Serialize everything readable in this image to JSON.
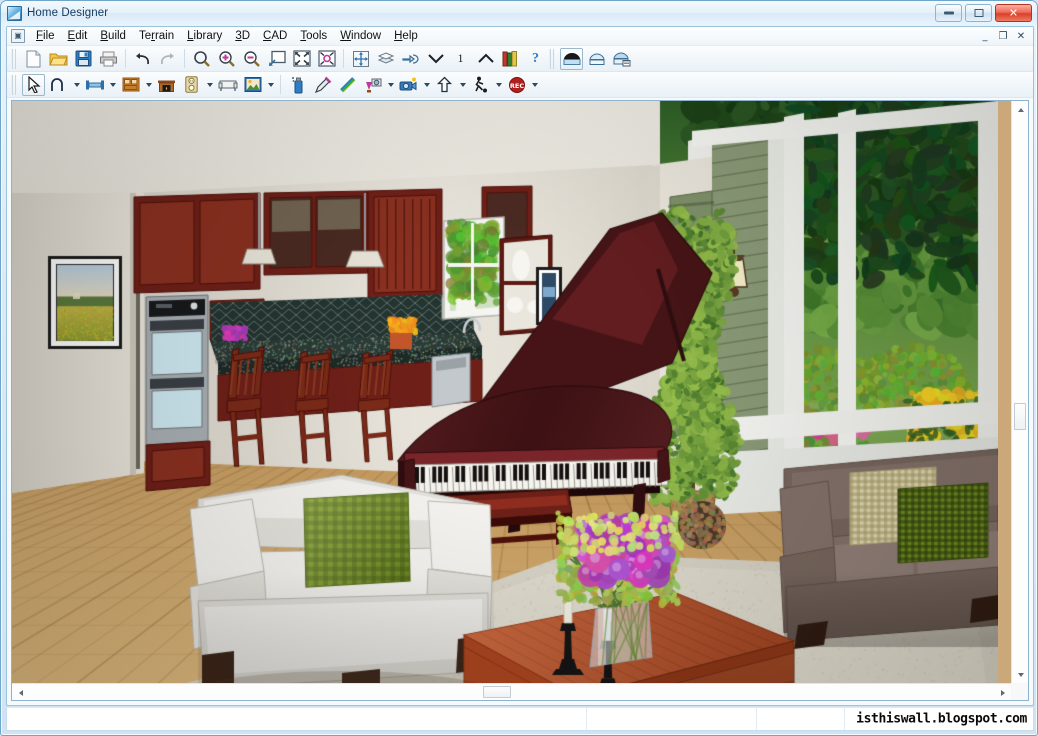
{
  "window": {
    "title": "Home Designer",
    "app_icon": "home-designer-logo-icon",
    "controls": {
      "minimize_label": "–",
      "maximize_label": "□",
      "close_label": "✕"
    }
  },
  "mdi": {
    "system_icon": "document-system-icon",
    "restore_label": "–",
    "maximize_label": "❐",
    "close_label": "✕"
  },
  "menubar": {
    "items": [
      {
        "label": "File",
        "accel": "F"
      },
      {
        "label": "Edit",
        "accel": "E"
      },
      {
        "label": "Build",
        "accel": "B"
      },
      {
        "label": "Terrain",
        "accel": "r"
      },
      {
        "label": "Library",
        "accel": "L"
      },
      {
        "label": "3D",
        "accel": "3"
      },
      {
        "label": "CAD",
        "accel": "C"
      },
      {
        "label": "Tools",
        "accel": "T"
      },
      {
        "label": "Window",
        "accel": "W"
      },
      {
        "label": "Help",
        "accel": "H"
      }
    ]
  },
  "toolbar_standard": {
    "buttons": [
      {
        "icon": "new-document-icon",
        "tooltip": "New Plan"
      },
      {
        "icon": "open-folder-icon",
        "tooltip": "Open Plan"
      },
      {
        "icon": "save-disk-icon",
        "tooltip": "Save Plan"
      },
      {
        "icon": "printer-icon",
        "tooltip": "Print"
      },
      {
        "icon": "undo-arrow-icon",
        "tooltip": "Undo"
      },
      {
        "icon": "redo-arrow-icon",
        "tooltip": "Redo",
        "disabled": true
      },
      {
        "icon": "zoom-magnifier-icon",
        "tooltip": "Zoom"
      },
      {
        "icon": "zoom-in-icon",
        "tooltip": "Zoom In"
      },
      {
        "icon": "zoom-out-icon",
        "tooltip": "Zoom Out"
      },
      {
        "icon": "fill-window-icon",
        "tooltip": "Fill Window"
      },
      {
        "icon": "fit-all-icon",
        "tooltip": "Fill Window Building Only"
      },
      {
        "icon": "center-target-icon",
        "tooltip": "Center View"
      },
      {
        "icon": "pan-move-icon",
        "tooltip": "Pan Window"
      },
      {
        "icon": "floor-up-down-icon",
        "tooltip": "Reference Display"
      },
      {
        "icon": "hand-point-icon",
        "tooltip": "Select Floor"
      },
      {
        "icon": "down-chevron-icon",
        "tooltip": "Down One Floor"
      },
      {
        "icon": "floor-number-icon",
        "tooltip": "Floor 1"
      },
      {
        "icon": "up-chevron-icon",
        "tooltip": "Up One Floor"
      },
      {
        "icon": "library-books-icon",
        "tooltip": "Library Browser"
      },
      {
        "icon": "help-question-icon",
        "tooltip": "Help"
      },
      {
        "icon": "camera-full-view-icon",
        "tooltip": "Full Camera"
      },
      {
        "icon": "house-overview-icon",
        "tooltip": "Overview"
      },
      {
        "icon": "house-doll-icon",
        "tooltip": "Doll House View"
      }
    ]
  },
  "toolbar_tools": {
    "buttons": [
      {
        "icon": "select-arrow-icon",
        "tooltip": "Select Objects",
        "active": true
      },
      {
        "icon": "curve-line-icon",
        "tooltip": "CAD Tools",
        "has_dropdown": true
      },
      {
        "icon": "wall-tool-icon",
        "tooltip": "Walls",
        "has_dropdown": true
      },
      {
        "icon": "cabinet-tool-icon",
        "tooltip": "Cabinets",
        "has_dropdown": true
      },
      {
        "icon": "fireplace-tool-icon",
        "tooltip": "Fireplace"
      },
      {
        "icon": "outlet-electrical-icon",
        "tooltip": "Electrical",
        "has_dropdown": true
      },
      {
        "icon": "furniture-tool-icon",
        "tooltip": "Furniture"
      },
      {
        "icon": "picture-frame-icon",
        "tooltip": "Interior Design",
        "has_dropdown": true
      },
      {
        "icon": "spray-can-icon",
        "tooltip": "Material Painter"
      },
      {
        "icon": "eyedropper-icon",
        "tooltip": "Material Eyedropper"
      },
      {
        "icon": "rainbow-blend-icon",
        "tooltip": "Material Blend"
      },
      {
        "icon": "plant-camera-icon",
        "tooltip": "Terrain & Plants",
        "has_dropdown": true
      },
      {
        "icon": "camera-tool-icon",
        "tooltip": "Cameras",
        "has_dropdown": true
      },
      {
        "icon": "up-arrow-tool-icon",
        "tooltip": "Elevation",
        "has_dropdown": true
      },
      {
        "icon": "walkthrough-icon",
        "tooltip": "Walkthrough",
        "has_dropdown": true
      },
      {
        "icon": "record-rec-icon",
        "tooltip": "Record Walkthrough",
        "has_dropdown": true
      }
    ]
  },
  "viewport": {
    "name": "3d-perspective-render",
    "description": "3D rendered interior: living room with grand piano, white armchair, cherry coffee table, brown sofa, kitchen beyond and garden through windows"
  },
  "scrollbars": {
    "vertical": {
      "thumb_top_pct": 52,
      "thumb_height_pct": 5
    },
    "horizontal": {
      "thumb_left_pct": 47,
      "thumb_width_pct": 3
    }
  },
  "statusbar": {
    "message": "",
    "pane_b": "",
    "pane_c": "",
    "watermark": "isthiswall.blogspot.com"
  },
  "colors": {
    "accent": "#2a6e9e",
    "titlebar": "#e4f0fa",
    "close_red": "#d8402c",
    "wood_floor": "#c79a5d",
    "carpet": "#d9d4c8",
    "piano": "#3b1012",
    "sofa_brown": "#85736c",
    "pillow_green": "#7b9b2e",
    "cabinet_cherry": "#6e2018",
    "siding_green": "#8b9b77",
    "foliage": "#3f7a2c"
  }
}
